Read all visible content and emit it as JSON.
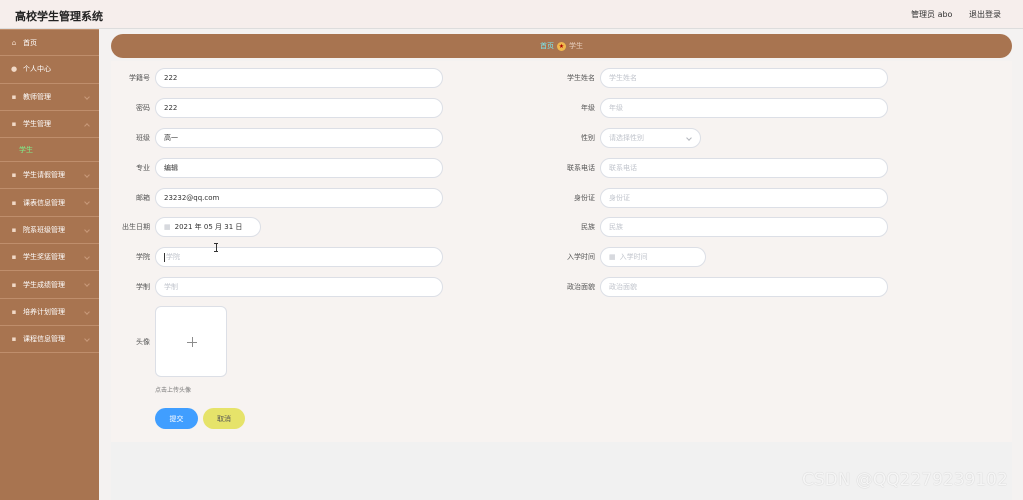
{
  "header": {
    "app_title": "高校学生管理系统",
    "admin_label": "管理员 abo",
    "logout_label": "退出登录"
  },
  "sidebar": {
    "items": [
      {
        "label": "首页",
        "icon": "home-icon"
      },
      {
        "label": "个人中心",
        "icon": "user-icon"
      },
      {
        "label": "教师管理",
        "icon": "menu-icon"
      },
      {
        "label": "学生管理",
        "icon": "menu-icon"
      },
      {
        "label": "学生请假管理",
        "icon": "menu-icon"
      },
      {
        "label": "课表信息管理",
        "icon": "menu-icon"
      },
      {
        "label": "院系班级管理",
        "icon": "menu-icon"
      },
      {
        "label": "学生奖惩管理",
        "icon": "menu-icon"
      },
      {
        "label": "学生成绩管理",
        "icon": "menu-icon"
      },
      {
        "label": "培养计划管理",
        "icon": "menu-icon"
      },
      {
        "label": "课程信息管理",
        "icon": "menu-icon"
      }
    ],
    "sub_items": {
      "student": "学生"
    }
  },
  "breadcrumb": {
    "home": "首页",
    "current": "学生"
  },
  "form": {
    "left": {
      "student_no": {
        "label": "学籍号",
        "value": "222"
      },
      "password": {
        "label": "密码",
        "value": "222"
      },
      "class": {
        "label": "班级",
        "value": "高一"
      },
      "major": {
        "label": "专业",
        "value": "编辑"
      },
      "email": {
        "label": "邮箱",
        "value": "23232@qq.com"
      },
      "birthday": {
        "label": "出生日期",
        "value": "2021 年 05 月 31 日"
      },
      "college": {
        "label": "学院",
        "placeholder": "学院"
      },
      "schooling": {
        "label": "学制",
        "placeholder": "学制"
      },
      "avatar": {
        "label": "头像",
        "hint": "点击上传头像"
      }
    },
    "right": {
      "student_name": {
        "label": "学生姓名",
        "placeholder": "学生姓名"
      },
      "grade": {
        "label": "年级",
        "placeholder": "年级"
      },
      "gender": {
        "label": "性别",
        "placeholder": "请选择性别"
      },
      "phone": {
        "label": "联系电话",
        "placeholder": "联系电话"
      },
      "id_card": {
        "label": "身份证",
        "placeholder": "身份证"
      },
      "ethnicity": {
        "label": "民族",
        "placeholder": "民族"
      },
      "enroll_time": {
        "label": "入学时间",
        "placeholder": "入学时间"
      },
      "political": {
        "label": "政治面貌",
        "placeholder": "政治面貌"
      }
    },
    "submit_label": "提交",
    "cancel_label": "取消"
  },
  "watermark": "CSDN @QQ2279239102",
  "colors": {
    "sidebar_bg": "#a87450",
    "breadcrumb_bg": "#a87450",
    "active_submenu": "#7ef08a",
    "submit_button": "#409eff",
    "cancel_button": "#e6e36a"
  }
}
